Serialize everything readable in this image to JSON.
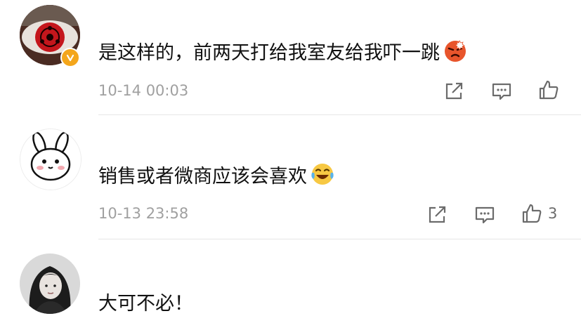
{
  "comments": [
    {
      "avatar_icon": "sharingan-eye-avatar",
      "verified_badge_icon": "verified-v-icon",
      "text": "是这样的，前两天打给我室友给我吓一跳",
      "emoji_icon": "angry-face-emoji",
      "timestamp": "10-14 00:03",
      "like_count": ""
    },
    {
      "avatar_icon": "rabbit-cartoon-avatar",
      "text": "销售或者微商应该会喜欢",
      "emoji_icon": "laughing-crying-emoji",
      "timestamp": "10-13 23:58",
      "like_count": "3"
    },
    {
      "avatar_icon": "girl-photo-avatar",
      "text": "大可不必！"
    }
  ],
  "colors": {
    "text": "#111111",
    "meta": "#a0a0a0",
    "icon": "#6b6b6b",
    "verified_badge": "#f4a61b",
    "divider": "#e6e6e6"
  }
}
